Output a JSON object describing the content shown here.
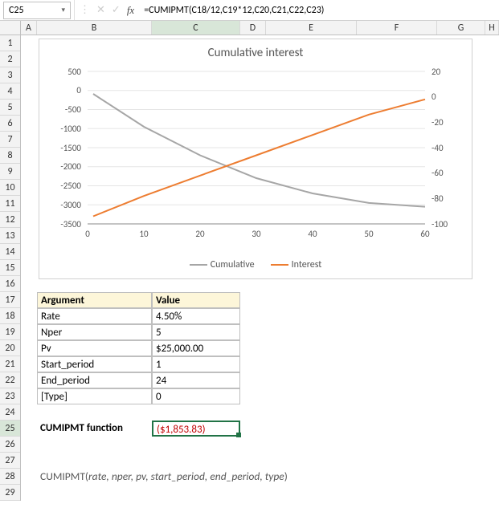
{
  "namebox": "C25",
  "formula": "=CUMIPMT(C18/12,C19*12,C20,C21,C22,C23)",
  "columns": [
    "A",
    "B",
    "C",
    "D",
    "E",
    "F",
    "G",
    "H"
  ],
  "rows": [
    "1",
    "2",
    "3",
    "4",
    "5",
    "6",
    "7",
    "8",
    "9",
    "10",
    "11",
    "12",
    "13",
    "14",
    "15",
    "16",
    "17",
    "18",
    "19",
    "20",
    "21",
    "22",
    "23",
    "24",
    "25",
    "26",
    "27",
    "28",
    "29"
  ],
  "chart": {
    "title": "Cumulative interest",
    "legend": {
      "a": "Cumulative",
      "b": "Interest"
    }
  },
  "table": {
    "h_arg": "Argument",
    "h_val": "Value",
    "rows": [
      {
        "arg": "Rate",
        "val": "4.50%"
      },
      {
        "arg": "Nper",
        "val": "5"
      },
      {
        "arg": "Pv",
        "val": "$25,000.00"
      },
      {
        "arg": "Start_period",
        "val": "1"
      },
      {
        "arg": "End_period",
        "val": "24"
      },
      {
        "arg": "[Type]",
        "val": "0"
      }
    ]
  },
  "result_label": "CUMIPMT function",
  "result_value": "($1,853.83)",
  "syntax": {
    "fn": "CUMIPMT(",
    "args": "rate, nper, pv, start_period, end_period, type",
    "close": ")"
  },
  "chart_data": {
    "type": "line",
    "title": "Cumulative interest",
    "x": [
      0,
      10,
      20,
      30,
      40,
      50,
      60
    ],
    "xlim": [
      0,
      60
    ],
    "series": [
      {
        "name": "Cumulative",
        "axis": "left",
        "ylim": [
          -3500,
          500
        ],
        "yticks": [
          500,
          0,
          -500,
          -1000,
          -1500,
          -2000,
          -2500,
          -3000,
          -3500
        ],
        "values_at_ticks": [
          -100,
          -950,
          -1700,
          -2300,
          -2700,
          -2950,
          -3050
        ]
      },
      {
        "name": "Interest",
        "axis": "right",
        "ylim": [
          -100,
          20
        ],
        "yticks": [
          20,
          0,
          -20,
          -40,
          -60,
          -80,
          -100
        ],
        "values_at_ticks": [
          -94,
          -78,
          -62,
          -46,
          -30,
          -14,
          -2
        ]
      }
    ]
  }
}
